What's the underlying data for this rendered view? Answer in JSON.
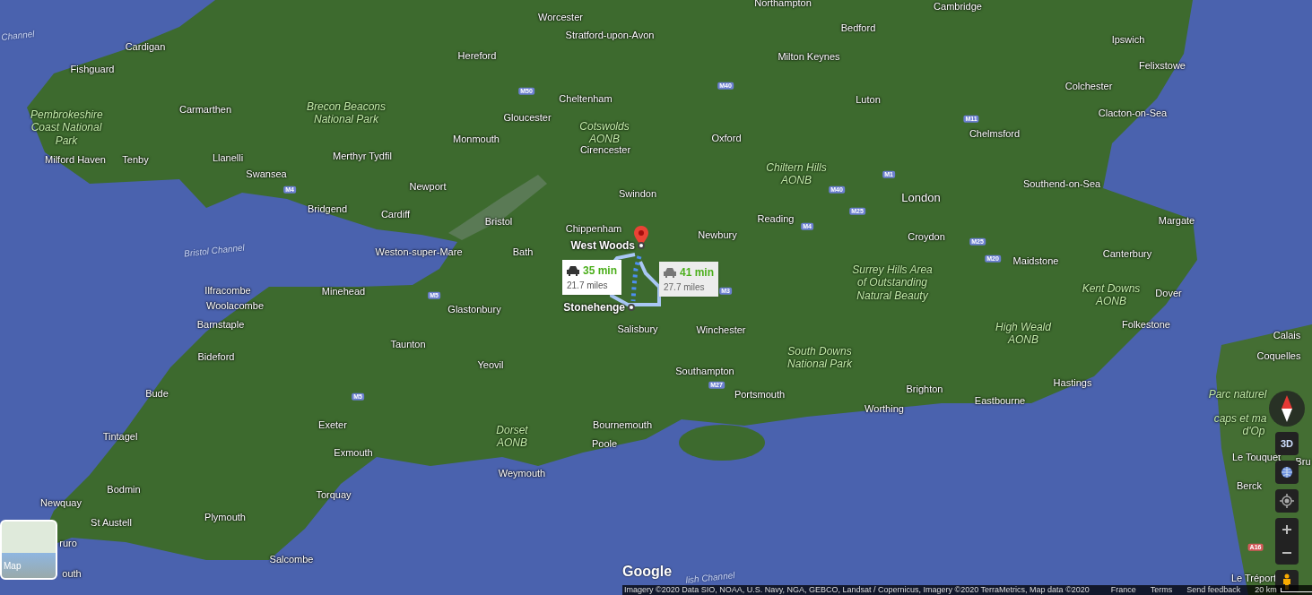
{
  "map": {
    "labels": [
      {
        "text": "Channel",
        "kind": "water"
      },
      {
        "text": "Worcester",
        "kind": "place"
      },
      {
        "text": "Stratford-upon-Avon",
        "kind": "place"
      },
      {
        "text": "Northampton",
        "kind": "place"
      },
      {
        "text": "Bedford",
        "kind": "place"
      },
      {
        "text": "Cambridge",
        "kind": "place"
      },
      {
        "text": "Ipswich",
        "kind": "place"
      },
      {
        "text": "Felixstowe",
        "kind": "place"
      },
      {
        "text": "Colchester",
        "kind": "place"
      },
      {
        "text": "Clacton-on-Sea",
        "kind": "place"
      },
      {
        "text": "Chelmsford",
        "kind": "place"
      },
      {
        "text": "Southend-on-Sea",
        "kind": "place"
      },
      {
        "text": "Milton Keynes",
        "kind": "place"
      },
      {
        "text": "Luton",
        "kind": "place"
      },
      {
        "text": "Oxford",
        "kind": "place"
      },
      {
        "text": "Hereford",
        "kind": "place"
      },
      {
        "text": "Cheltenham",
        "kind": "place"
      },
      {
        "text": "Gloucester",
        "kind": "place"
      },
      {
        "text": "Cirencester",
        "kind": "place"
      },
      {
        "text": "Swindon",
        "kind": "place"
      },
      {
        "text": "Monmouth",
        "kind": "place"
      },
      {
        "text": "Newport",
        "kind": "place"
      },
      {
        "text": "Cardiff",
        "kind": "place"
      },
      {
        "text": "Bristol",
        "kind": "place"
      },
      {
        "text": "Chippenham",
        "kind": "place"
      },
      {
        "text": "Weston-super-Mare",
        "kind": "place"
      },
      {
        "text": "Bath",
        "kind": "place"
      },
      {
        "text": "Bridgend",
        "kind": "place"
      },
      {
        "text": "Swansea",
        "kind": "place"
      },
      {
        "text": "Llanelli",
        "kind": "place"
      },
      {
        "text": "Merthyr Tydfil",
        "kind": "place"
      },
      {
        "text": "Carmarthen",
        "kind": "place"
      },
      {
        "text": "Cardigan",
        "kind": "place"
      },
      {
        "text": "Fishguard",
        "kind": "place"
      },
      {
        "text": "Milford Haven",
        "kind": "place"
      },
      {
        "text": "Tenby",
        "kind": "place"
      },
      {
        "text": "Reading",
        "kind": "place"
      },
      {
        "text": "Newbury",
        "kind": "place"
      },
      {
        "text": "London",
        "kind": "city"
      },
      {
        "text": "Croydon",
        "kind": "place"
      },
      {
        "text": "Margate",
        "kind": "place"
      },
      {
        "text": "Canterbury",
        "kind": "place"
      },
      {
        "text": "Maidstone",
        "kind": "place"
      },
      {
        "text": "Dover",
        "kind": "place"
      },
      {
        "text": "Folkestone",
        "kind": "place"
      },
      {
        "text": "Hastings",
        "kind": "place"
      },
      {
        "text": "Eastbourne",
        "kind": "place"
      },
      {
        "text": "Brighton",
        "kind": "place"
      },
      {
        "text": "Worthing",
        "kind": "place"
      },
      {
        "text": "Winchester",
        "kind": "place"
      },
      {
        "text": "Southampton",
        "kind": "place"
      },
      {
        "text": "Portsmouth",
        "kind": "place"
      },
      {
        "text": "Salisbury",
        "kind": "place"
      },
      {
        "text": "Ilfracombe",
        "kind": "place"
      },
      {
        "text": "Minehead",
        "kind": "place"
      },
      {
        "text": "Woolacombe",
        "kind": "place"
      },
      {
        "text": "Glastonbury",
        "kind": "place"
      },
      {
        "text": "Barnstaple",
        "kind": "place"
      },
      {
        "text": "Taunton",
        "kind": "place"
      },
      {
        "text": "Bideford",
        "kind": "place"
      },
      {
        "text": "Yeovil",
        "kind": "place"
      },
      {
        "text": "Bude",
        "kind": "place"
      },
      {
        "text": "Exeter",
        "kind": "place"
      },
      {
        "text": "Bournemouth",
        "kind": "place"
      },
      {
        "text": "Tintagel",
        "kind": "place"
      },
      {
        "text": "Poole",
        "kind": "place"
      },
      {
        "text": "Exmouth",
        "kind": "place"
      },
      {
        "text": "Weymouth",
        "kind": "place"
      },
      {
        "text": "Bodmin",
        "kind": "place"
      },
      {
        "text": "Torquay",
        "kind": "place"
      },
      {
        "text": "Newquay",
        "kind": "place"
      },
      {
        "text": "Plymouth",
        "kind": "place"
      },
      {
        "text": "St Austell",
        "kind": "place"
      },
      {
        "text": "ruro",
        "kind": "place"
      },
      {
        "text": "Salcombe",
        "kind": "place"
      },
      {
        "text": "outh",
        "kind": "place"
      },
      {
        "text": "Calais",
        "kind": "place"
      },
      {
        "text": "Coquelles",
        "kind": "place"
      },
      {
        "text": "Le Touquet",
        "kind": "place"
      },
      {
        "text": "Bru",
        "kind": "place"
      },
      {
        "text": "Berck",
        "kind": "place"
      },
      {
        "text": "Le Tréport",
        "kind": "place"
      },
      {
        "text": "Pembrokeshire Coast National Park",
        "kind": "park"
      },
      {
        "text": "Brecon Beacons National Park",
        "kind": "park"
      },
      {
        "text": "Cotswolds AONB",
        "kind": "park"
      },
      {
        "text": "Chiltern Hills AONB",
        "kind": "park"
      },
      {
        "text": "Surrey Hills Area of Outstanding Natural Beauty",
        "kind": "park"
      },
      {
        "text": "Kent Downs AONB",
        "kind": "park"
      },
      {
        "text": "High Weald AONB",
        "kind": "park"
      },
      {
        "text": "South Downs National Park",
        "kind": "park"
      },
      {
        "text": "Dorset AONB",
        "kind": "park"
      },
      {
        "text": "Parc naturel",
        "kind": "park"
      },
      {
        "text": "caps et ma",
        "kind": "park"
      },
      {
        "text": "d'Op",
        "kind": "park"
      },
      {
        "text": "Bristol Channel",
        "kind": "water"
      },
      {
        "text": "lish Channel",
        "kind": "water"
      },
      {
        "text": "M50",
        "kind": "road"
      },
      {
        "text": "M40",
        "kind": "road"
      },
      {
        "text": "M11",
        "kind": "road"
      },
      {
        "text": "M4",
        "kind": "road"
      },
      {
        "text": "M1",
        "kind": "road"
      },
      {
        "text": "M40",
        "kind": "road"
      },
      {
        "text": "M25",
        "kind": "road"
      },
      {
        "text": "M4",
        "kind": "road"
      },
      {
        "text": "M25",
        "kind": "road"
      },
      {
        "text": "M20",
        "kind": "road"
      },
      {
        "text": "M5",
        "kind": "road"
      },
      {
        "text": "M3",
        "kind": "road"
      },
      {
        "text": "M27",
        "kind": "road"
      },
      {
        "text": "M5",
        "kind": "road"
      },
      {
        "text": "A16",
        "kind": "road"
      }
    ],
    "route": {
      "origin": "West Woods",
      "destination": "Stonehenge",
      "options": [
        {
          "duration": "35 min",
          "distance": "21.7 miles",
          "selected": true
        },
        {
          "duration": "41 min",
          "distance": "27.7 miles",
          "selected": false
        }
      ]
    }
  },
  "logo": "Google",
  "minimap": {
    "label": "Map"
  },
  "controls": {
    "tilt_button": "3D"
  },
  "footer": {
    "attribution": "Imagery ©2020 Data SIO, NOAA, U.S. Navy, NGA, GEBCO, Landsat / Copernicus, Imagery ©2020 TerraMetrics, Map data ©2020",
    "links": [
      "France",
      "Terms",
      "Send feedback"
    ],
    "scale": "20 km"
  }
}
